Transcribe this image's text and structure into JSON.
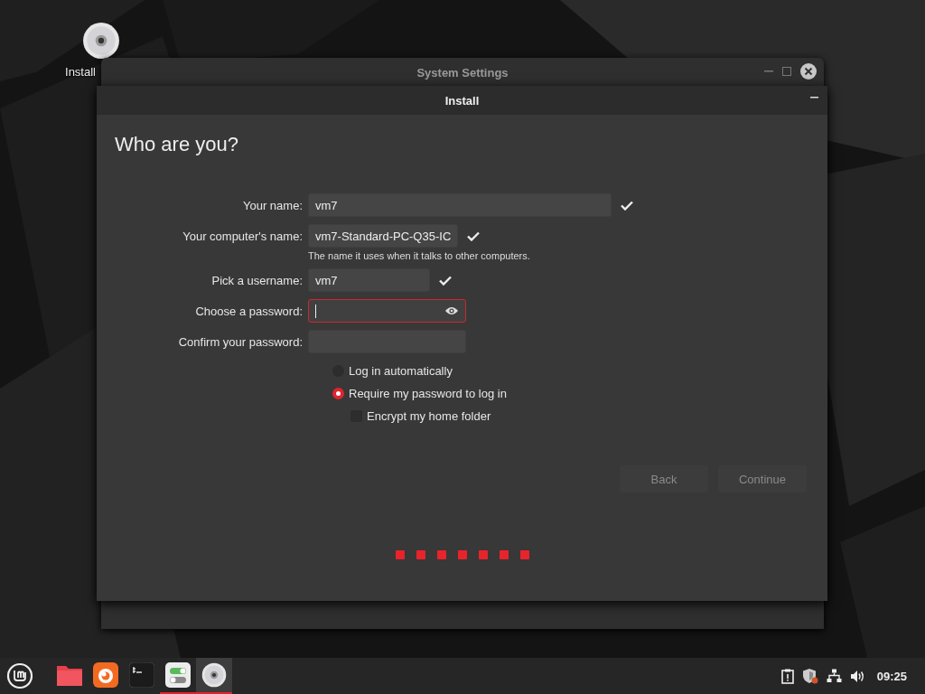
{
  "desktop": {
    "icons": [
      {
        "label": "Install"
      }
    ]
  },
  "background_window": {
    "title": "System Settings"
  },
  "window": {
    "title": "Install",
    "heading": "Who are you?",
    "fields": [
      {
        "label": "Your name:",
        "value": "vm7",
        "valid": true,
        "focused": false
      },
      {
        "label": "Your computer's name:",
        "value": "vm7-Standard-PC-Q35-IC",
        "valid": true,
        "focused": false,
        "hint": "The name it uses when it talks to other computers."
      },
      {
        "label": "Pick a username:",
        "value": "vm7",
        "valid": true,
        "focused": false
      },
      {
        "label": "Choose a password:",
        "kind": "password",
        "valid": false,
        "focused": true
      },
      {
        "label": "Confirm your password:",
        "kind": "password-confirm",
        "valid": false,
        "focused": false
      }
    ],
    "login_options": [
      {
        "label": "Log in automatically",
        "kind": "radio",
        "selected": false
      },
      {
        "label": "Require my password to log in",
        "kind": "radio",
        "selected": true
      },
      {
        "label": "Encrypt my home folder",
        "kind": "checkbox",
        "checked": false
      }
    ],
    "buttons": [
      {
        "label": "Back",
        "disabled": true
      },
      {
        "label": "Continue",
        "disabled": true
      }
    ],
    "steps": [
      {
        "done": true
      },
      {
        "done": true
      },
      {
        "done": true
      },
      {
        "done": true
      },
      {
        "done": true
      },
      {
        "done": true
      },
      {
        "done": true
      }
    ]
  },
  "taskbar": {
    "apps": [
      {
        "kind": "folder",
        "running": false,
        "active": false
      },
      {
        "kind": "browser",
        "running": false,
        "active": false
      },
      {
        "kind": "terminal",
        "running": false,
        "active": false
      },
      {
        "kind": "settings",
        "running": true,
        "active": false
      },
      {
        "kind": "disc",
        "running": true,
        "active": true
      }
    ],
    "clock": "09:25"
  }
}
